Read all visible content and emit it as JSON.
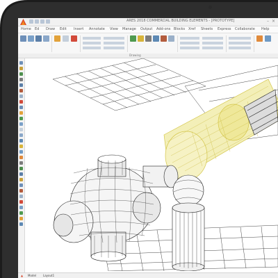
{
  "window": {
    "title": "ARES 2018 COMMERCIAL BUILDING ELEMENTS - [PROTOTYPE]"
  },
  "menu": {
    "tabs": [
      "Home",
      "Ed",
      "Draw",
      "Edit",
      "Insert",
      "Annotate",
      "View",
      "Manage",
      "Output",
      "Add-ons",
      "Blocks",
      "Xref",
      "Sheets",
      "Express",
      "Collaborate",
      "Help"
    ]
  },
  "ribbon": {
    "panel_label": "Drawing"
  },
  "status": {
    "tabs": [
      "Model",
      "Layout1"
    ]
  },
  "colors": {
    "logo_red": "#d8462a",
    "logo_orange": "#f08a1d",
    "drawing_line": "#222222",
    "selection_yellow": "#e9e07a"
  },
  "icons": [
    "app-logo-icon",
    "save-icon",
    "undo-icon",
    "redo-icon",
    "print-icon",
    "minimize-icon",
    "close-icon"
  ]
}
